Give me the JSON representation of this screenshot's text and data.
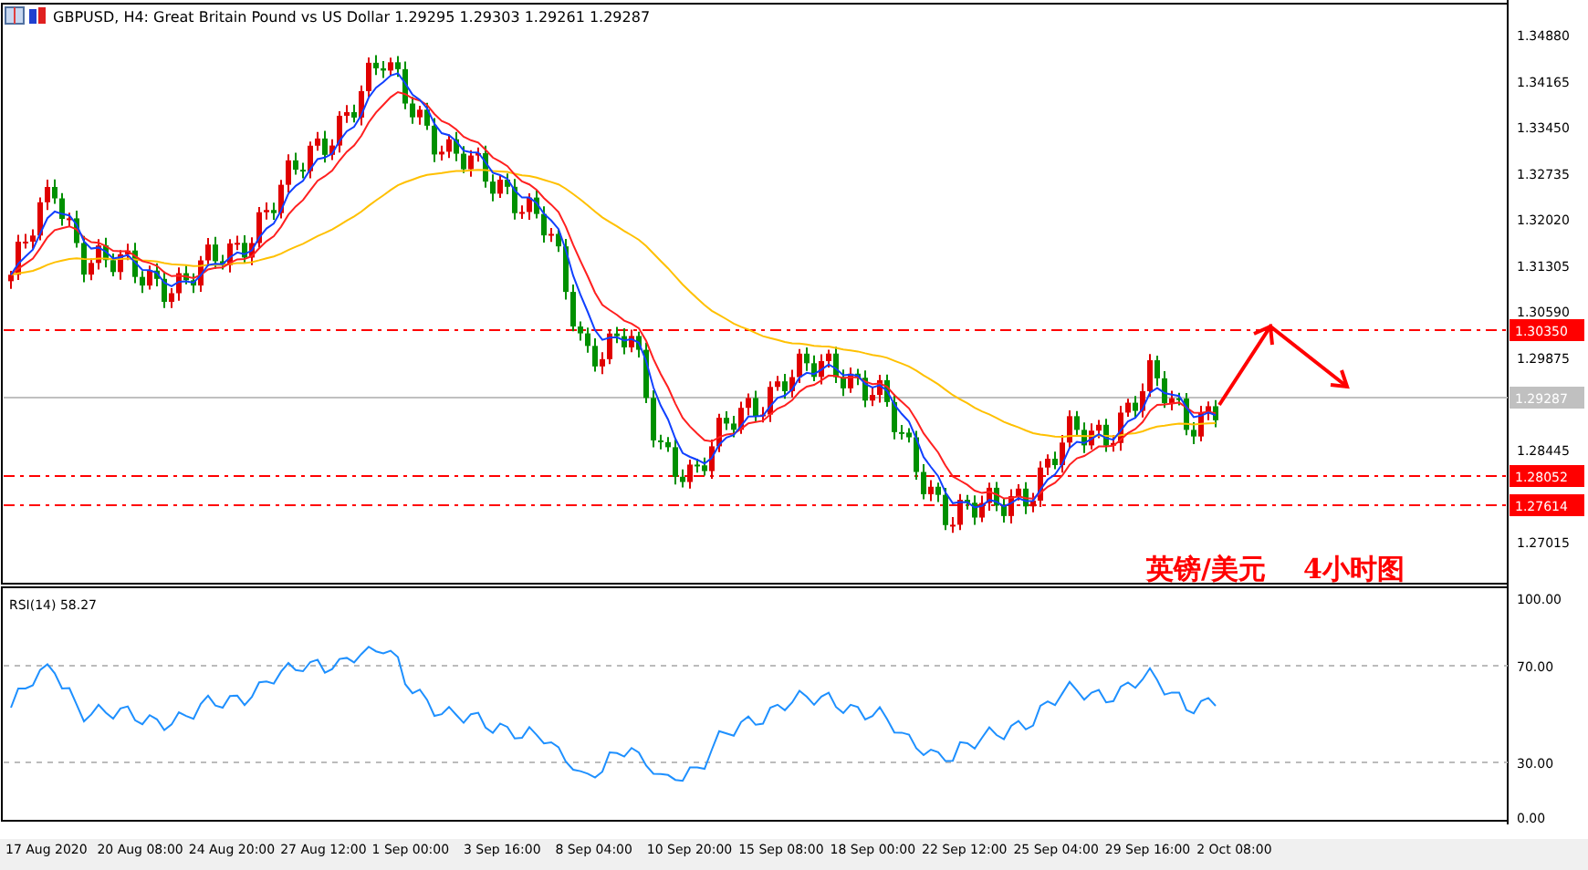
{
  "title": "GBPUSD, H4:  Great Britain Pound vs US Dollar  1.29295 1.29303 1.29261 1.29287",
  "price_ticks": [
    "1.34880",
    "1.34165",
    "1.33450",
    "1.32735",
    "1.32020",
    "1.31305",
    "1.30590",
    "1.29875",
    "1.28445",
    "1.27015"
  ],
  "levels": [
    {
      "label": "1.30350",
      "color": "#ff0000"
    },
    {
      "label": "1.29287",
      "color": "#c0c0c0"
    },
    {
      "label": "1.28052",
      "color": "#ff0000"
    },
    {
      "label": "1.27614",
      "color": "#ff0000"
    }
  ],
  "annotation": [
    "英镑/美元",
    "4小时图"
  ],
  "rsi": {
    "label": "RSI(14) 58.27",
    "ticks": [
      "100.00",
      "70.00",
      "30.00",
      "0.00"
    ]
  },
  "time_ticks": [
    "17 Aug 2020",
    "20 Aug 08:00",
    "24 Aug 20:00",
    "27 Aug 12:00",
    "1 Sep 00:00",
    "3 Sep 16:00",
    "8 Sep 04:00",
    "10 Sep 20:00",
    "15 Sep 08:00",
    "18 Sep 00:00",
    "22 Sep 12:00",
    "25 Sep 04:00",
    "29 Sep 16:00",
    "2 Oct 08:00"
  ]
}
